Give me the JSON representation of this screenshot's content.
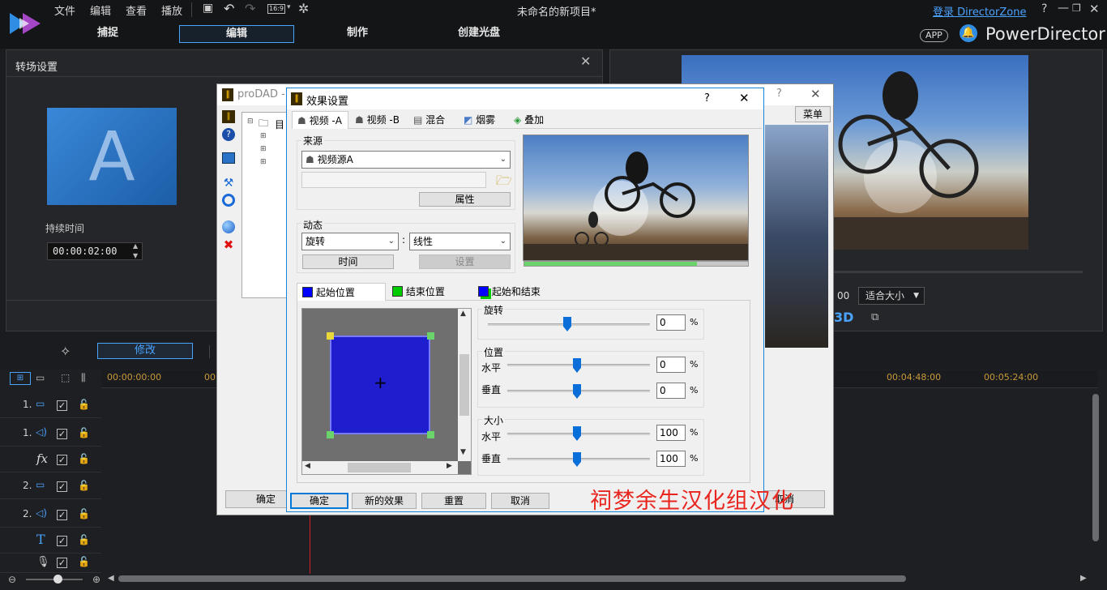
{
  "app": {
    "window_title": "未命名的新项目*",
    "login_link": "登录 DirectorZone",
    "brand": "PowerDirector",
    "app_badge": "APP",
    "menu": [
      "文件",
      "编辑",
      "查看",
      "播放"
    ],
    "aspect": "16:9",
    "modes": [
      "捕捉",
      "编辑",
      "制作",
      "创建光盘"
    ]
  },
  "transition_panel": {
    "title": "转场设置",
    "thumb_letter": "A",
    "duration_label": "持续时间",
    "duration_value": "00:00:02:00"
  },
  "toolbar": {
    "modify_label": "修改"
  },
  "prodad": {
    "title": "proDAD -",
    "tree_root": "目",
    "menu_btn": "菜单",
    "ok_btn": "确定",
    "cancel_btn": "取消"
  },
  "effect_dialog": {
    "title": "效果设置",
    "help": "?",
    "tabs": [
      "视频 -A",
      "视频 -B",
      "混合",
      "烟雾",
      "叠加"
    ],
    "source_label": "来源",
    "source_value": "视频源A",
    "properties_btn": "属性",
    "motion_label": "动态",
    "motion_value": "旋转",
    "curve_value": "线性",
    "time_btn": "时间",
    "settings_btn": "设置",
    "pos_tabs": [
      "起始位置",
      "结束位置",
      "起始和结束"
    ],
    "pos_tab_colors": [
      "#0000ff",
      "#00cc00",
      "#0000ff"
    ],
    "rotate_label": "旋转",
    "rotate_value": "0",
    "position_label": "位置",
    "horizontal_label": "水平",
    "vertical_label": "垂直",
    "pos_h_value": "0",
    "pos_v_value": "0",
    "size_label": "大小",
    "size_h_value": "100",
    "size_v_value": "100",
    "percent": "%",
    "footer_buttons": [
      "确定",
      "新的效果",
      "重置",
      "取消"
    ],
    "watermark": "祠梦余生汉化组汉化",
    "progress": 0.77
  },
  "preview_panel": {
    "timecode_tail": "00",
    "fit_label": "适合大小",
    "badge_3d": "3D"
  },
  "timeline": {
    "timecodes": [
      "00:00:00:00",
      "00:0",
      "00:04:48:00",
      "00:05:24:00"
    ],
    "tracks": [
      {
        "num": "1.",
        "type": "video"
      },
      {
        "num": "1.",
        "type": "audio"
      },
      {
        "num": "",
        "type": "fx"
      },
      {
        "num": "2.",
        "type": "video"
      },
      {
        "num": "2.",
        "type": "audio"
      },
      {
        "num": "",
        "type": "title"
      },
      {
        "num": "",
        "type": "voice"
      }
    ],
    "fx_label": "fx",
    "title_label": "T"
  },
  "colors": {
    "accent": "#4aa3ff",
    "blue_box": "#1e1ecf",
    "watermark": "#e8261f"
  }
}
